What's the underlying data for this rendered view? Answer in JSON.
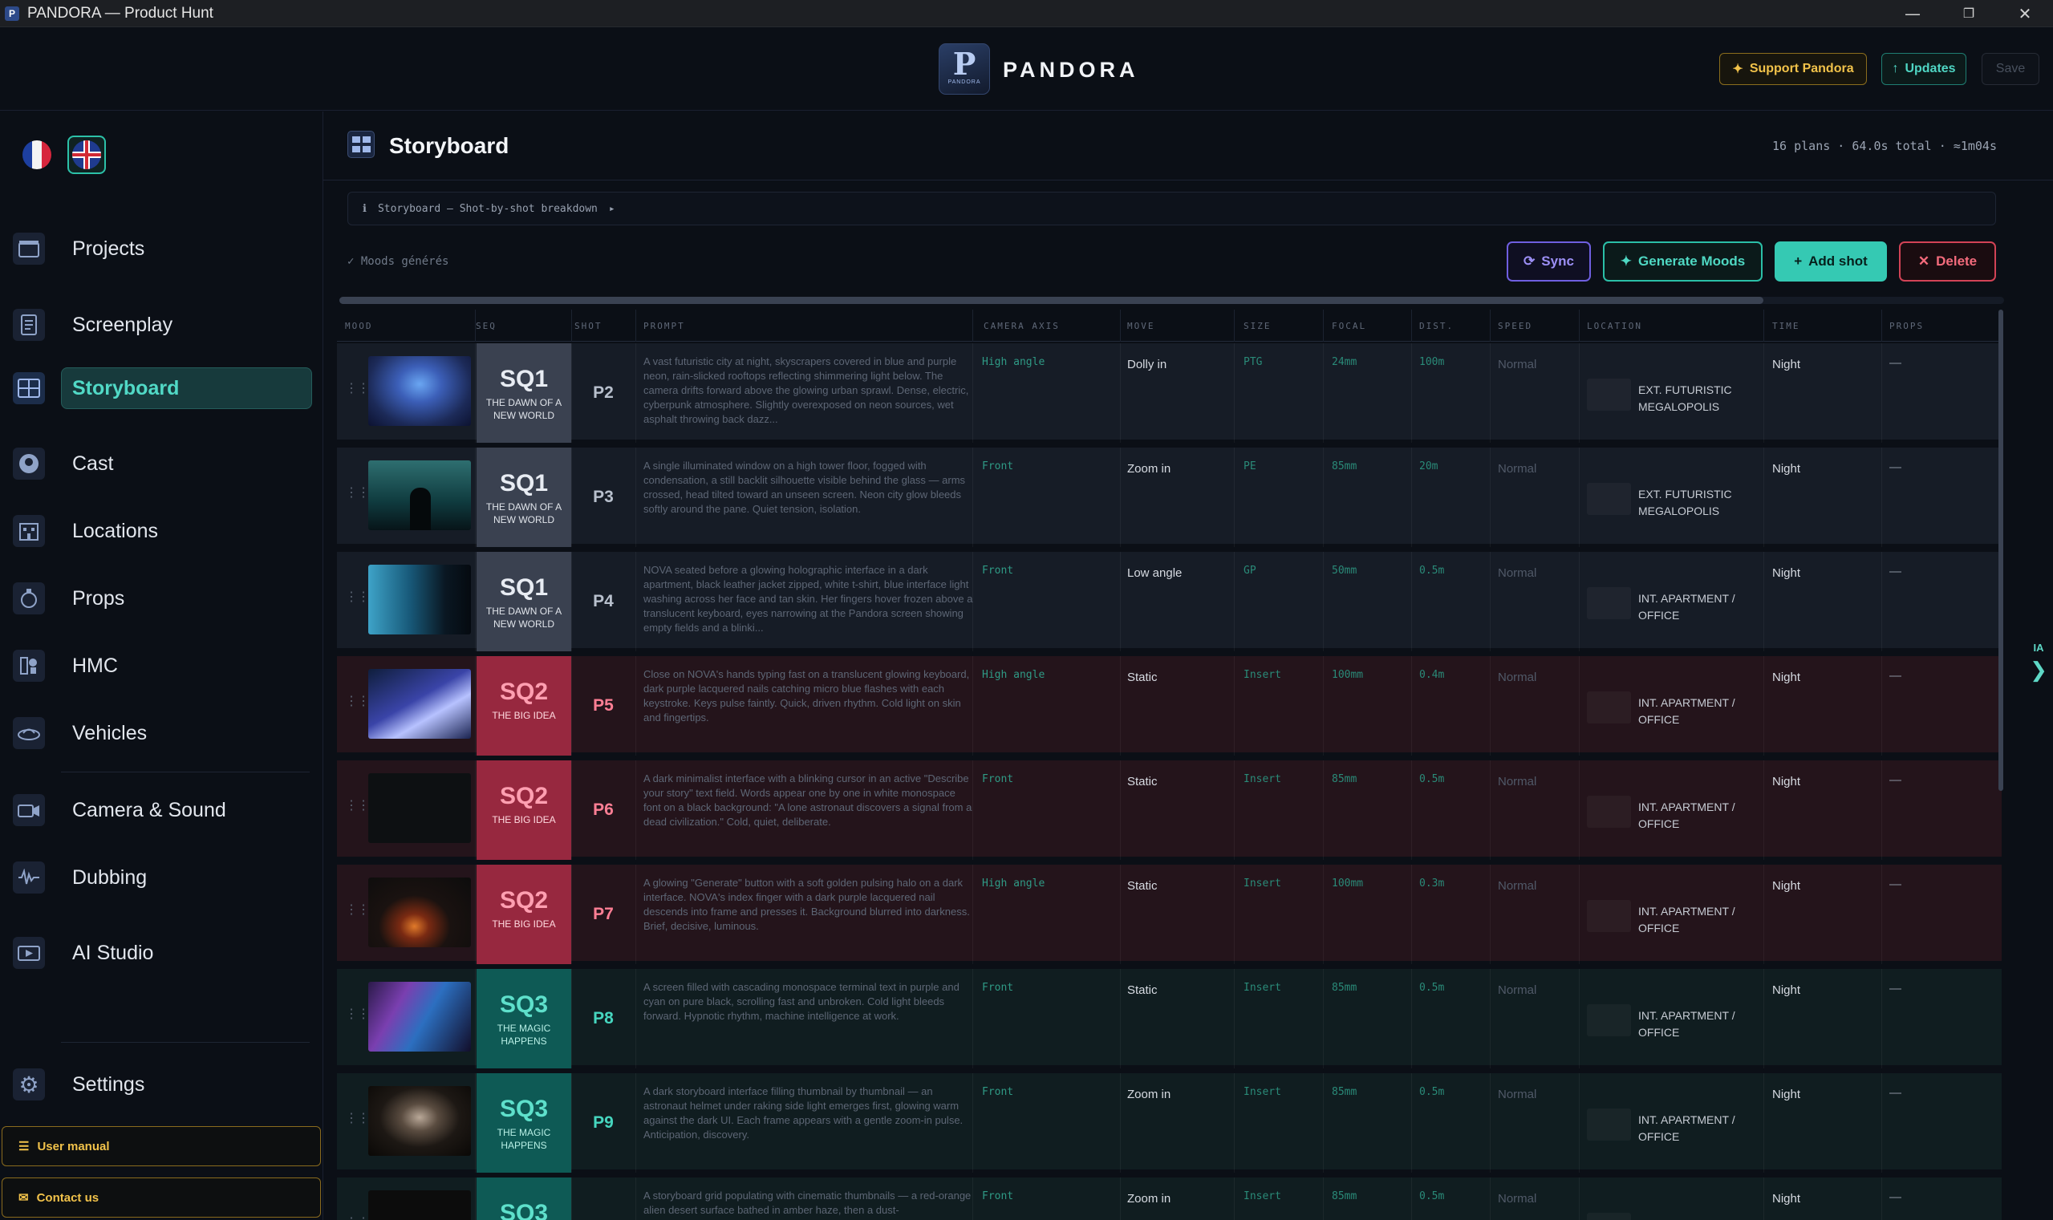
{
  "window": {
    "title": "PANDORA — Product Hunt",
    "controls": [
      "—",
      "❐",
      "✕"
    ]
  },
  "header": {
    "brand": "PANDORA",
    "logo_letter": "P",
    "logo_sub": "PANDORA",
    "support_label": "Support Pandora",
    "updates_label": "Updates",
    "save_label": "Save"
  },
  "sidebar": {
    "items": [
      {
        "label": "Projects",
        "icon": "film-icon"
      },
      {
        "label": "Screenplay",
        "icon": "document-icon"
      },
      {
        "label": "Storyboard",
        "icon": "grid-icon",
        "active": true
      },
      {
        "label": "Cast",
        "icon": "person-icon"
      },
      {
        "label": "Locations",
        "icon": "building-icon"
      },
      {
        "label": "Props",
        "icon": "object-icon"
      },
      {
        "label": "HMC",
        "icon": "makeup-icon"
      },
      {
        "label": "Vehicles",
        "icon": "vehicle-icon"
      },
      {
        "label": "Camera & Sound",
        "icon": "camera-icon"
      },
      {
        "label": "Dubbing",
        "icon": "waveform-icon"
      },
      {
        "label": "AI Studio",
        "icon": "ai-studio-icon"
      },
      {
        "label": "Settings",
        "icon": "gear-icon"
      }
    ],
    "user_manual": "User manual",
    "contact_us": "Contact us"
  },
  "page": {
    "title": "Storyboard",
    "stats": "16 plans  ·  64.0s total  ·  ≈1m04s",
    "breadcrumb": "Storyboard — Shot-by-shot breakdown",
    "moods_note": "✓ Moods générés",
    "sync_label": "Sync",
    "generate_moods_label": "Generate Moods",
    "add_shot_label": "Add shot",
    "delete_label": "Delete",
    "ia_label": "IA"
  },
  "table": {
    "columns": [
      "MOOD",
      "SEQ",
      "SHOT",
      "PROMPT",
      "CAMERA AXIS",
      "MOVE",
      "SIZE",
      "FOCAL",
      "DIST.",
      "SPEED",
      "LOCATION",
      "TIME",
      "PROPS"
    ],
    "rows": [
      {
        "seq": "SQ1",
        "seq_name": "THE DAWN OF A NEW WORLD",
        "shot": "P2",
        "prompt": "A vast futuristic city at night, skyscrapers covered in blue and purple neon, rain-slicked rooftops reflecting shimmering light below. The camera drifts forward above the glowing urban sprawl. Dense, electric, cyberpunk atmosphere. Slightly overexposed on neon sources, wet asphalt throwing back dazz...",
        "camera": "High angle",
        "move": "Dolly in",
        "size": "PTG",
        "focal": "24mm",
        "dist": "100m",
        "speed": "Normal",
        "location": "EXT. FUTURISTIC MEGALOPOLIS",
        "time": "Night",
        "props": "—"
      },
      {
        "seq": "SQ1",
        "seq_name": "THE DAWN OF A NEW WORLD",
        "shot": "P3",
        "prompt": "A single illuminated window on a high tower floor, fogged with condensation, a still backlit silhouette visible behind the glass — arms crossed, head tilted toward an unseen screen. Neon city glow bleeds softly around the pane. Quiet tension, isolation.",
        "camera": "Front",
        "move": "Zoom in",
        "size": "PE",
        "focal": "85mm",
        "dist": "20m",
        "speed": "Normal",
        "location": "EXT. FUTURISTIC MEGALOPOLIS",
        "time": "Night",
        "props": "—"
      },
      {
        "seq": "SQ1",
        "seq_name": "THE DAWN OF A NEW WORLD",
        "shot": "P4",
        "prompt": "NOVA seated before a glowing holographic interface in a dark apartment, black leather jacket zipped, white t-shirt, blue interface light washing across her face and tan skin. Her fingers hover frozen above a translucent keyboard, eyes narrowing at the Pandora screen showing empty fields and a blinki...",
        "camera": "Front",
        "move": "Low angle",
        "size": "GP",
        "focal": "50mm",
        "dist": "0.5m",
        "speed": "Normal",
        "location": "INT. APARTMENT / OFFICE",
        "time": "Night",
        "props": "—"
      },
      {
        "seq": "SQ2",
        "seq_name": "THE BIG IDEA",
        "shot": "P5",
        "prompt": "Close on NOVA's hands typing fast on a translucent glowing keyboard, dark purple lacquered nails catching micro blue flashes with each keystroke. Keys pulse faintly. Quick, driven rhythm. Cold light on skin and fingertips.",
        "camera": "High angle",
        "move": "Static",
        "size": "Insert",
        "focal": "100mm",
        "dist": "0.4m",
        "speed": "Normal",
        "location": "INT. APARTMENT / OFFICE",
        "time": "Night",
        "props": "—"
      },
      {
        "seq": "SQ2",
        "seq_name": "THE BIG IDEA",
        "shot": "P6",
        "prompt": "A dark minimalist interface with a blinking cursor in an active \"Describe your story\" text field. Words appear one by one in white monospace font on a black background: \"A lone astronaut discovers a signal from a dead civilization.\" Cold, quiet, deliberate.",
        "camera": "Front",
        "move": "Static",
        "size": "Insert",
        "focal": "85mm",
        "dist": "0.5m",
        "speed": "Normal",
        "location": "INT. APARTMENT / OFFICE",
        "time": "Night",
        "props": "—"
      },
      {
        "seq": "SQ2",
        "seq_name": "THE BIG IDEA",
        "shot": "P7",
        "prompt": "A glowing \"Generate\" button with a soft golden pulsing halo on a dark interface. NOVA's index finger with a dark purple lacquered nail descends into frame and presses it. Background blurred into darkness. Brief, decisive, luminous.",
        "camera": "High angle",
        "move": "Static",
        "size": "Insert",
        "focal": "100mm",
        "dist": "0.3m",
        "speed": "Normal",
        "location": "INT. APARTMENT / OFFICE",
        "time": "Night",
        "props": "—"
      },
      {
        "seq": "SQ3",
        "seq_name": "THE MAGIC HAPPENS",
        "shot": "P8",
        "prompt": "A screen filled with cascading monospace terminal text in purple and cyan on pure black, scrolling fast and unbroken. Cold light bleeds forward. Hypnotic rhythm, machine intelligence at work.",
        "camera": "Front",
        "move": "Static",
        "size": "Insert",
        "focal": "85mm",
        "dist": "0.5m",
        "speed": "Normal",
        "location": "INT. APARTMENT / OFFICE",
        "time": "Night",
        "props": "—"
      },
      {
        "seq": "SQ3",
        "seq_name": "THE MAGIC HAPPENS",
        "shot": "P9",
        "prompt": "A dark storyboard interface filling thumbnail by thumbnail — an astronaut helmet under raking side light emerges first, glowing warm against the dark UI. Each frame appears with a gentle zoom-in pulse. Anticipation, discovery.",
        "camera": "Front",
        "move": "Zoom in",
        "size": "Insert",
        "focal": "85mm",
        "dist": "0.5m",
        "speed": "Normal",
        "location": "INT. APARTMENT / OFFICE",
        "time": "Night",
        "props": "—"
      },
      {
        "seq": "SQ3",
        "seq_name": "",
        "shot": "",
        "prompt": "A storyboard grid populating with cinematic thumbnails — a red-orange alien desert surface bathed in amber haze, then a dust-",
        "camera": "Front",
        "move": "Zoom in",
        "size": "Insert",
        "focal": "85mm",
        "dist": "0.5m",
        "speed": "Normal",
        "location": "",
        "time": "Night",
        "props": "—"
      }
    ]
  }
}
